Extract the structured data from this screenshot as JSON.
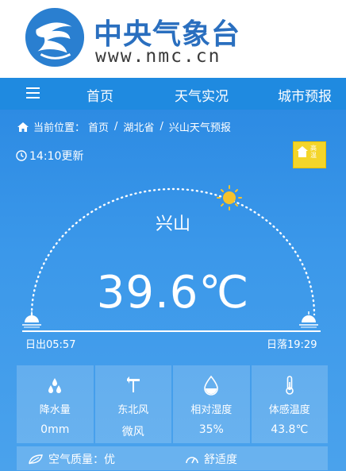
{
  "header": {
    "title": "中央气象台",
    "url": "www.nmc.cn"
  },
  "nav": {
    "items": [
      {
        "label": "首页"
      },
      {
        "label": "天气实况"
      },
      {
        "label": "城市预报"
      }
    ]
  },
  "breadcrumb": {
    "prefix": "当前位置：",
    "items": [
      "首页",
      "湖北省",
      "兴山天气预报"
    ]
  },
  "update_time": "14:10更新",
  "warning_badge": {
    "text": "高温",
    "color": "#f4d52a"
  },
  "city": "兴山",
  "temperature": "39.6℃",
  "sun": {
    "sunrise": "日出05:57",
    "sunset": "日落19:29"
  },
  "stats": [
    {
      "icon": "raindrops-icon",
      "label": "降水量",
      "value": "0mm"
    },
    {
      "icon": "wind-vane-icon",
      "label": "东北风",
      "value": "微风"
    },
    {
      "icon": "humidity-drop-icon",
      "label": "相对湿度",
      "value": "35%"
    },
    {
      "icon": "thermometer-icon",
      "label": "体感温度",
      "value": "43.8℃"
    }
  ],
  "bottom": {
    "air_quality": "空气质量：优",
    "comfort": "舒适度"
  },
  "colors": {
    "brand": "#2a6fbf",
    "nav": "#1f8ae0",
    "panel": "#3b98ea",
    "sun": "#f6c22b"
  }
}
